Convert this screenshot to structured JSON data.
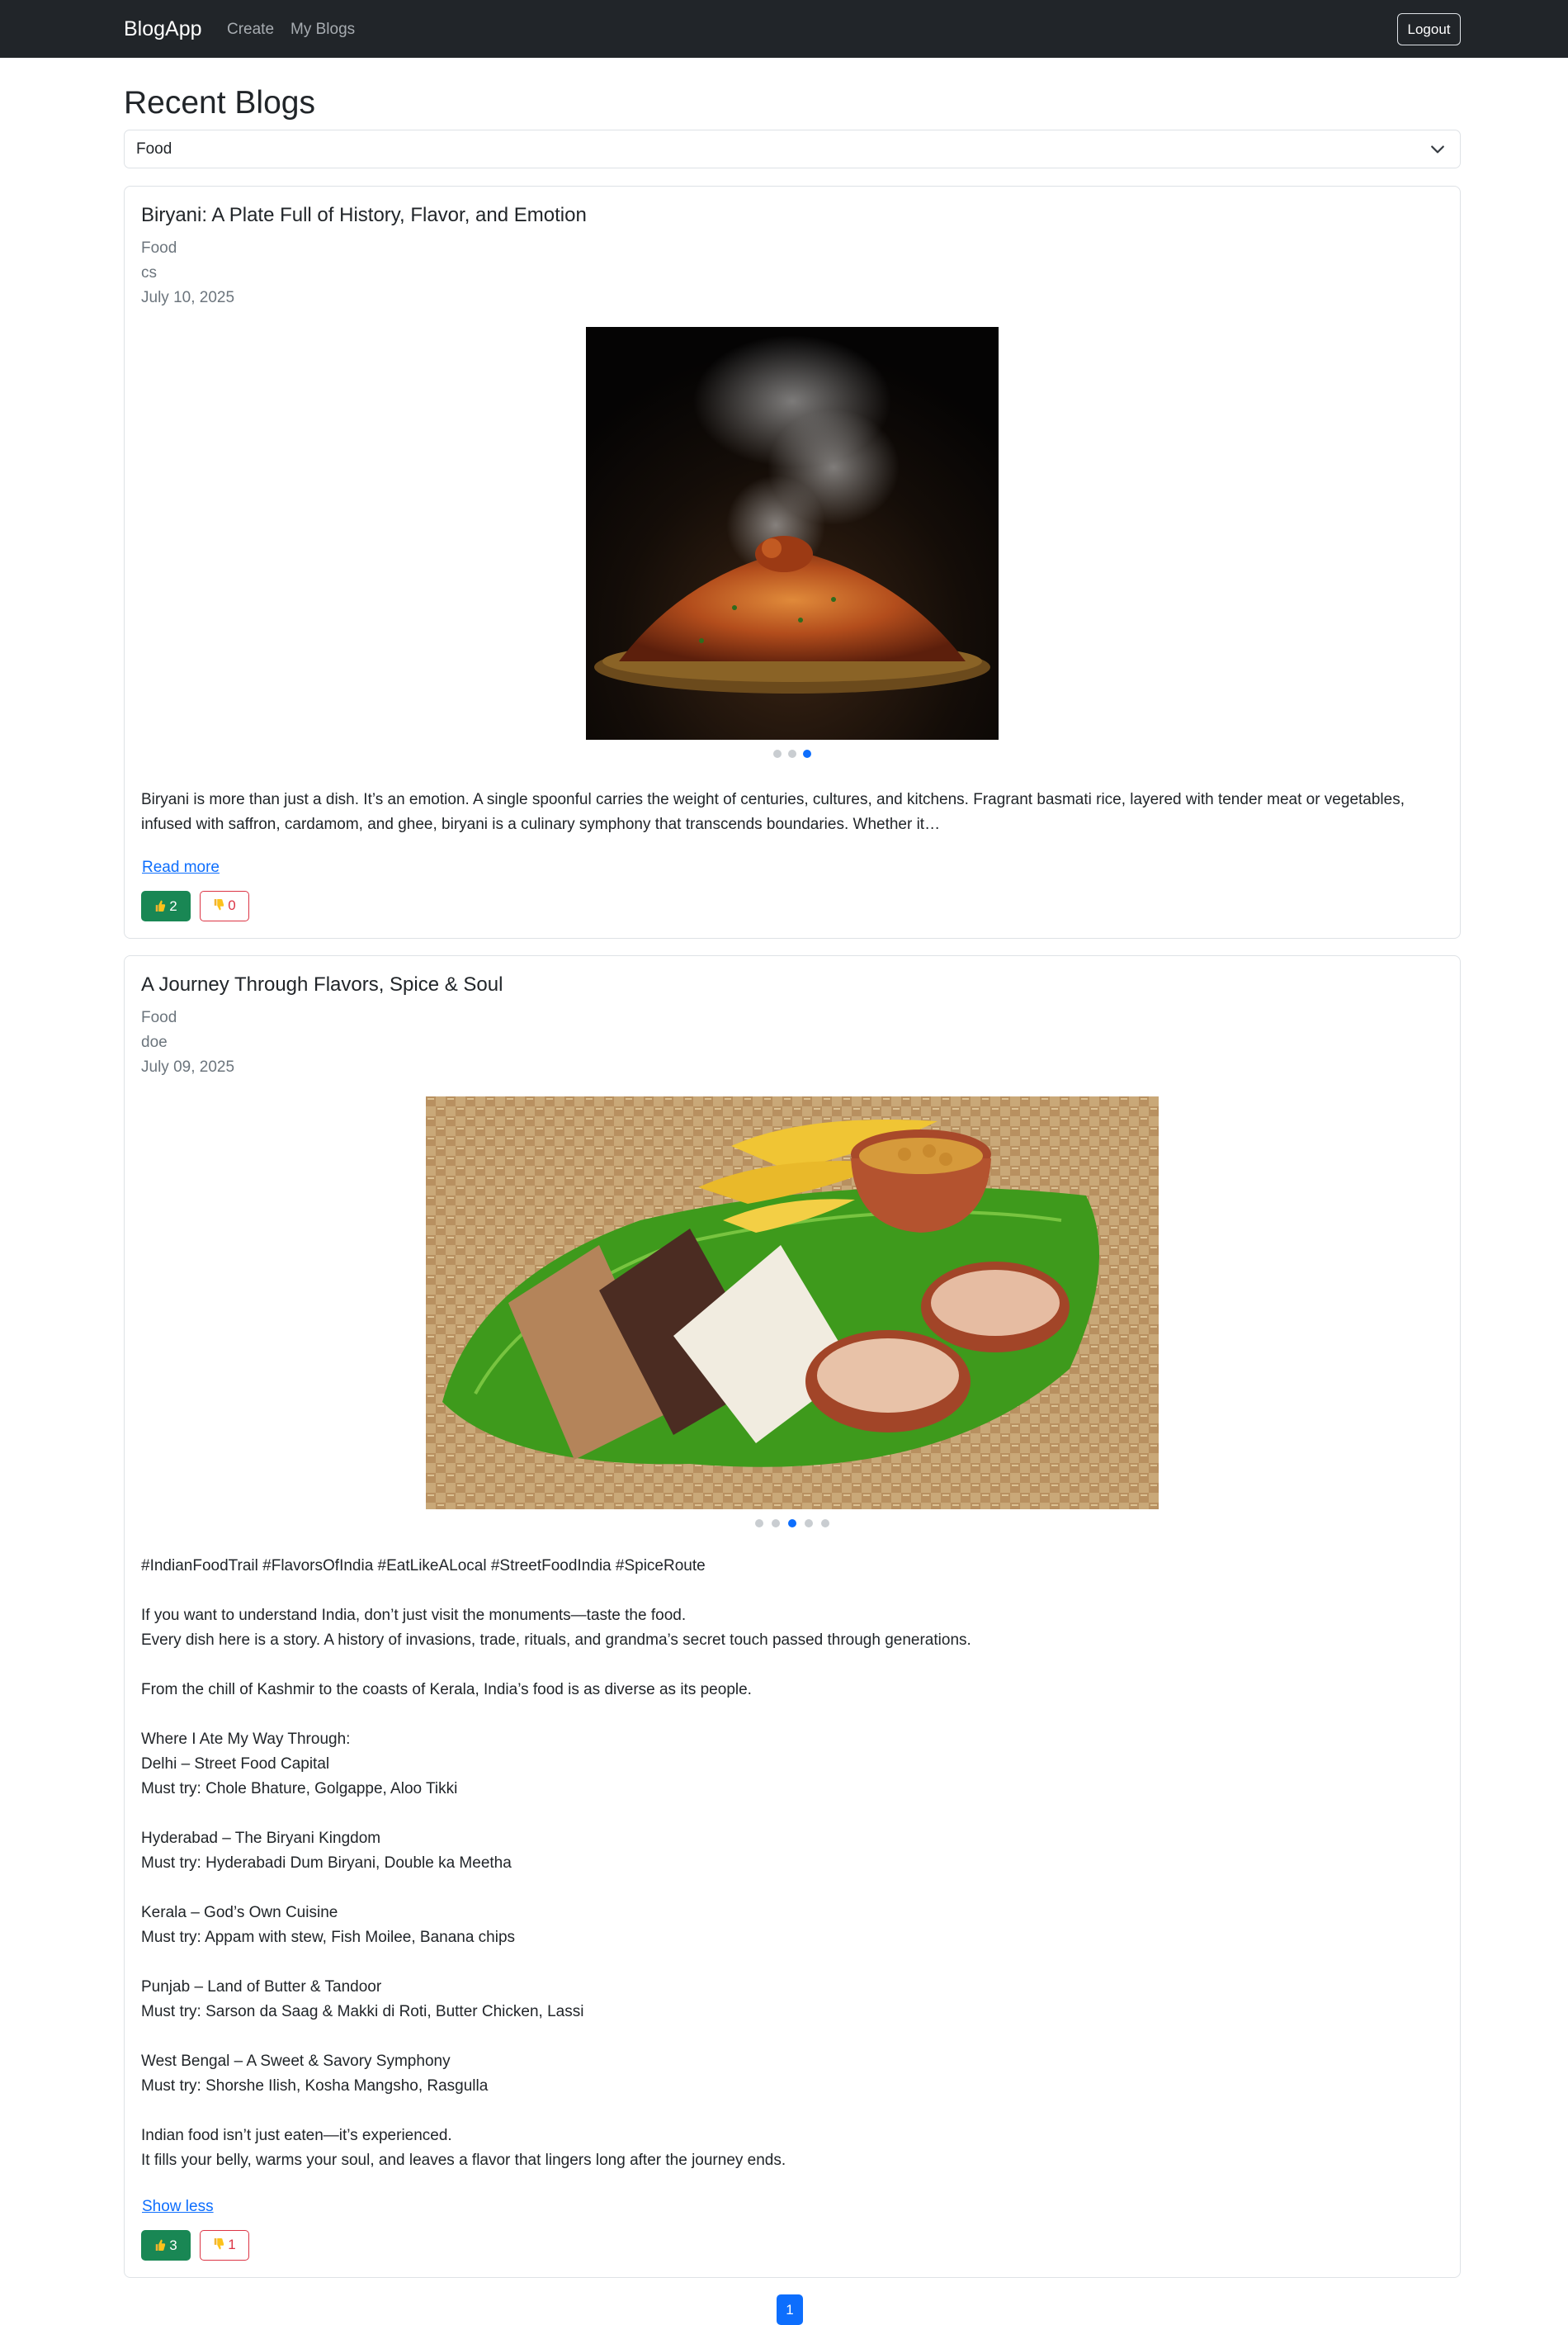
{
  "navbar": {
    "brand": "BlogApp",
    "links": [
      "Create",
      "My Blogs"
    ],
    "logout_label": "Logout"
  },
  "page": {
    "title": "Recent Blogs"
  },
  "filter": {
    "selected": "Food"
  },
  "posts": [
    {
      "title": "Biryani: A Plate Full of History, Flavor, and Emotion",
      "category": "Food",
      "author": "cs",
      "date": "July 10, 2025",
      "image_alt": "Steaming biryani on a plate",
      "carousel_count": 3,
      "carousel_active": 3,
      "excerpt": "Biryani is more than just a dish. It’s an emotion. A single spoonful carries the weight of centuries, cultures, and kitchens. Fragrant basmati rice, layered with tender meat or vegetables, infused with saffron, cardamom, and ghee, biryani is a culinary symphony that transcends boundaries. Whether it…",
      "toggle_label": "Read more",
      "likes": "2",
      "dislikes": "0"
    },
    {
      "title": "A Journey Through Flavors, Spice & Soul",
      "category": "Food",
      "author": "doe",
      "date": "July 09, 2025",
      "image_alt": "Puttu, chickpeas, bananas and tea on a banana leaf",
      "carousel_count": 5,
      "carousel_active": 3,
      "paragraphs": [
        "#IndianFoodTrail #FlavorsOfIndia #EatLikeALocal #StreetFoodIndia #SpiceRoute",
        "If you want to understand India, don’t just visit the monuments—taste the food.\nEvery dish here is a story. A history of invasions, trade, rituals, and grandma’s secret touch passed through generations.",
        "From the chill of Kashmir to the coasts of Kerala, India’s food is as diverse as its people.",
        "Where I Ate My Way Through:\nDelhi – Street Food Capital\nMust try: Chole Bhature, Golgappe, Aloo Tikki",
        "Hyderabad – The Biryani Kingdom\nMust try: Hyderabadi Dum Biryani, Double ka Meetha",
        "Kerala – God’s Own Cuisine\nMust try: Appam with stew, Fish Moilee, Banana chips",
        "Punjab – Land of Butter & Tandoor\nMust try: Sarson da Saag & Makki di Roti, Butter Chicken, Lassi",
        "West Bengal – A Sweet & Savory Symphony\nMust try: Shorshe Ilish, Kosha Mangsho, Rasgulla",
        "Indian food isn’t just eaten—it’s experienced.\nIt fills your belly, warms your soul, and leaves a flavor that lingers long after the journey ends."
      ],
      "toggle_label": "Show less",
      "likes": "3",
      "dislikes": "1"
    }
  ],
  "pagination": {
    "current": "1"
  },
  "colors": {
    "navbar_bg": "#212529",
    "primary": "#0d6efd",
    "success": "#198754",
    "danger": "#dc3545",
    "muted": "#6c757d"
  }
}
